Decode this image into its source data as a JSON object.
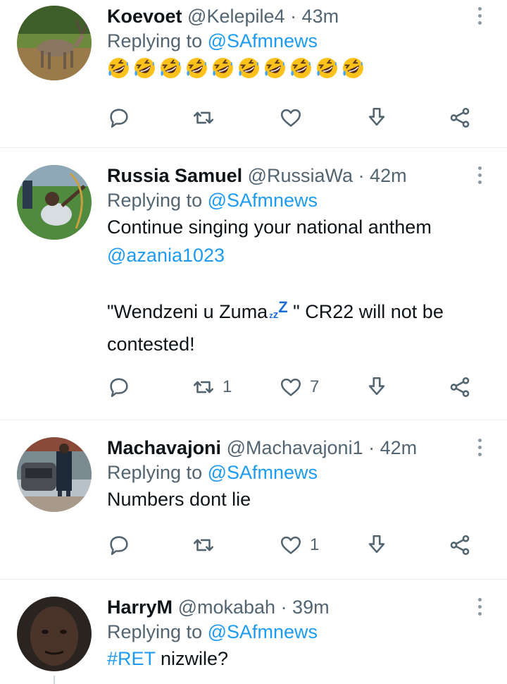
{
  "tweets": [
    {
      "name": "Koevoet",
      "handle": "@Kelepile4",
      "time": "· 43m",
      "replying_prefix": "Replying to ",
      "replying_to": "@SAfmnews",
      "emoji_count": 10,
      "emoji": "rolling-on-floor-laughing",
      "actions": {
        "reply": "",
        "retweet": "",
        "like": "",
        "share": ""
      }
    },
    {
      "name": "Russia Samuel",
      "handle": "@RussiaWa",
      "time": "· 42m",
      "replying_prefix": "Replying to ",
      "replying_to": "@SAfmnews",
      "line1": "Continue singing your national anthem",
      "mention": "@azania1023",
      "line2a": "\"Wendzeni u Zuma",
      "line2b": " \" CR22 will not be",
      "line3": "contested!",
      "actions": {
        "retweet": "1",
        "like": "7"
      }
    },
    {
      "name": "Machavajoni",
      "handle": "@Machavajoni1",
      "time": "· 42m",
      "replying_prefix": "Replying to ",
      "replying_to": "@SAfmnews",
      "text": "Numbers dont lie",
      "actions": {
        "retweet": "",
        "like": "1"
      }
    },
    {
      "name": "HarryM",
      "handle": "@mokabah",
      "time": "· 39m",
      "replying_prefix": "Replying to ",
      "replying_to": "@SAfmnews",
      "hashtag": "#RET",
      "text": " nizwile?"
    }
  ],
  "colors": {
    "link": "#1d9bf0",
    "muted": "#536471",
    "divider": "#e6ecf0"
  }
}
